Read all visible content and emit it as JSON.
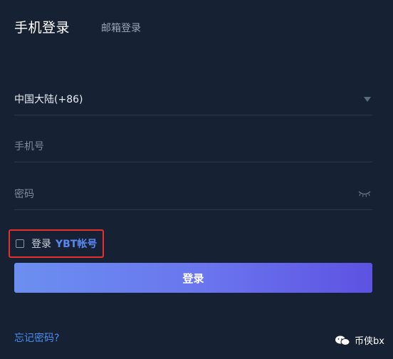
{
  "tabs": {
    "active": "手机登录",
    "inactive": "邮箱登录"
  },
  "form": {
    "country_value": "中国大陆(+86)",
    "phone_placeholder": "手机号",
    "password_placeholder": "密码"
  },
  "remember": {
    "label": "登录",
    "brand": "YBT帐号",
    "checked": false
  },
  "login_button": "登录",
  "forgot_link": "忘记密码?",
  "watermark": "币侠bx",
  "colors": {
    "background": "#162233",
    "accent": "#6a74ee",
    "link": "#4b8ef0",
    "highlight_border": "#e8302a"
  }
}
